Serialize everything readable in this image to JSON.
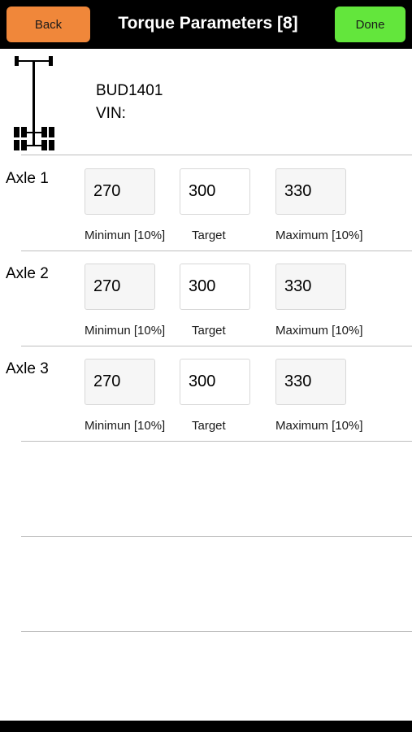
{
  "header": {
    "back_label": "Back",
    "title": "Torque Parameters [8]",
    "done_label": "Done"
  },
  "vehicle": {
    "id": "BUD1401",
    "vin_label": "VIN:",
    "diagram_icon": "axle-chassis-icon"
  },
  "captions": {
    "minimum": "Minimun [10%]",
    "target": "Target",
    "maximum": "Maximum [10%]"
  },
  "axles": [
    {
      "label": "Axle 1",
      "minimum": "270",
      "target": "300",
      "maximum": "330"
    },
    {
      "label": "Axle 2",
      "minimum": "270",
      "target": "300",
      "maximum": "330"
    },
    {
      "label": "Axle 3",
      "minimum": "270",
      "target": "300",
      "maximum": "330"
    }
  ],
  "colors": {
    "back_button": "#f0873a",
    "done_button": "#63e63c",
    "header_bg": "#000000"
  }
}
